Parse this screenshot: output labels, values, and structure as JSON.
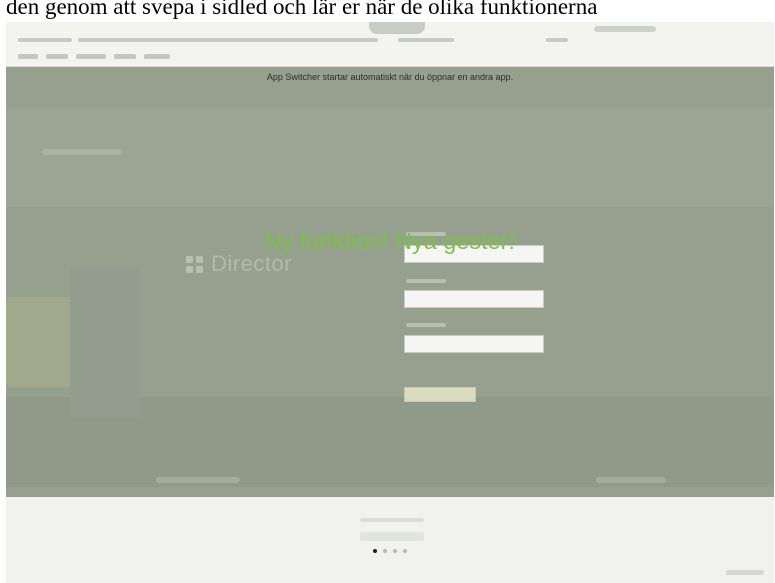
{
  "caption": {
    "text": "den genom att svepa i sidled och lär er när de olika funktionerna"
  },
  "overlay": {
    "info_text": "App Switcher startar automatiskt när du öppnar en andra app.",
    "logo_text": "Director"
  },
  "tutorial": {
    "headline_part1": "Ny funktion!",
    "headline_part2": "Nya gester!",
    "accent_color": "#7ac143"
  },
  "pager": {
    "pages": 4,
    "current_page": 1
  }
}
